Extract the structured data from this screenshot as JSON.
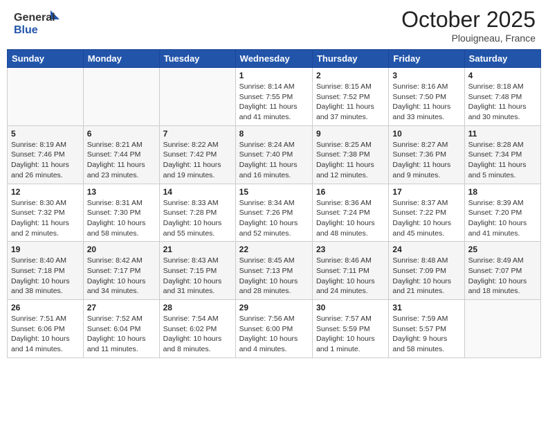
{
  "header": {
    "logo_general": "General",
    "logo_blue": "Blue",
    "month_title": "October 2025",
    "location": "Plouigneau, France"
  },
  "days_of_week": [
    "Sunday",
    "Monday",
    "Tuesday",
    "Wednesday",
    "Thursday",
    "Friday",
    "Saturday"
  ],
  "weeks": [
    [
      {
        "day": "",
        "info": ""
      },
      {
        "day": "",
        "info": ""
      },
      {
        "day": "",
        "info": ""
      },
      {
        "day": "1",
        "info": "Sunrise: 8:14 AM\nSunset: 7:55 PM\nDaylight: 11 hours and 41 minutes."
      },
      {
        "day": "2",
        "info": "Sunrise: 8:15 AM\nSunset: 7:52 PM\nDaylight: 11 hours and 37 minutes."
      },
      {
        "day": "3",
        "info": "Sunrise: 8:16 AM\nSunset: 7:50 PM\nDaylight: 11 hours and 33 minutes."
      },
      {
        "day": "4",
        "info": "Sunrise: 8:18 AM\nSunset: 7:48 PM\nDaylight: 11 hours and 30 minutes."
      }
    ],
    [
      {
        "day": "5",
        "info": "Sunrise: 8:19 AM\nSunset: 7:46 PM\nDaylight: 11 hours and 26 minutes."
      },
      {
        "day": "6",
        "info": "Sunrise: 8:21 AM\nSunset: 7:44 PM\nDaylight: 11 hours and 23 minutes."
      },
      {
        "day": "7",
        "info": "Sunrise: 8:22 AM\nSunset: 7:42 PM\nDaylight: 11 hours and 19 minutes."
      },
      {
        "day": "8",
        "info": "Sunrise: 8:24 AM\nSunset: 7:40 PM\nDaylight: 11 hours and 16 minutes."
      },
      {
        "day": "9",
        "info": "Sunrise: 8:25 AM\nSunset: 7:38 PM\nDaylight: 11 hours and 12 minutes."
      },
      {
        "day": "10",
        "info": "Sunrise: 8:27 AM\nSunset: 7:36 PM\nDaylight: 11 hours and 9 minutes."
      },
      {
        "day": "11",
        "info": "Sunrise: 8:28 AM\nSunset: 7:34 PM\nDaylight: 11 hours and 5 minutes."
      }
    ],
    [
      {
        "day": "12",
        "info": "Sunrise: 8:30 AM\nSunset: 7:32 PM\nDaylight: 11 hours and 2 minutes."
      },
      {
        "day": "13",
        "info": "Sunrise: 8:31 AM\nSunset: 7:30 PM\nDaylight: 10 hours and 58 minutes."
      },
      {
        "day": "14",
        "info": "Sunrise: 8:33 AM\nSunset: 7:28 PM\nDaylight: 10 hours and 55 minutes."
      },
      {
        "day": "15",
        "info": "Sunrise: 8:34 AM\nSunset: 7:26 PM\nDaylight: 10 hours and 52 minutes."
      },
      {
        "day": "16",
        "info": "Sunrise: 8:36 AM\nSunset: 7:24 PM\nDaylight: 10 hours and 48 minutes."
      },
      {
        "day": "17",
        "info": "Sunrise: 8:37 AM\nSunset: 7:22 PM\nDaylight: 10 hours and 45 minutes."
      },
      {
        "day": "18",
        "info": "Sunrise: 8:39 AM\nSunset: 7:20 PM\nDaylight: 10 hours and 41 minutes."
      }
    ],
    [
      {
        "day": "19",
        "info": "Sunrise: 8:40 AM\nSunset: 7:18 PM\nDaylight: 10 hours and 38 minutes."
      },
      {
        "day": "20",
        "info": "Sunrise: 8:42 AM\nSunset: 7:17 PM\nDaylight: 10 hours and 34 minutes."
      },
      {
        "day": "21",
        "info": "Sunrise: 8:43 AM\nSunset: 7:15 PM\nDaylight: 10 hours and 31 minutes."
      },
      {
        "day": "22",
        "info": "Sunrise: 8:45 AM\nSunset: 7:13 PM\nDaylight: 10 hours and 28 minutes."
      },
      {
        "day": "23",
        "info": "Sunrise: 8:46 AM\nSunset: 7:11 PM\nDaylight: 10 hours and 24 minutes."
      },
      {
        "day": "24",
        "info": "Sunrise: 8:48 AM\nSunset: 7:09 PM\nDaylight: 10 hours and 21 minutes."
      },
      {
        "day": "25",
        "info": "Sunrise: 8:49 AM\nSunset: 7:07 PM\nDaylight: 10 hours and 18 minutes."
      }
    ],
    [
      {
        "day": "26",
        "info": "Sunrise: 7:51 AM\nSunset: 6:06 PM\nDaylight: 10 hours and 14 minutes."
      },
      {
        "day": "27",
        "info": "Sunrise: 7:52 AM\nSunset: 6:04 PM\nDaylight: 10 hours and 11 minutes."
      },
      {
        "day": "28",
        "info": "Sunrise: 7:54 AM\nSunset: 6:02 PM\nDaylight: 10 hours and 8 minutes."
      },
      {
        "day": "29",
        "info": "Sunrise: 7:56 AM\nSunset: 6:00 PM\nDaylight: 10 hours and 4 minutes."
      },
      {
        "day": "30",
        "info": "Sunrise: 7:57 AM\nSunset: 5:59 PM\nDaylight: 10 hours and 1 minute."
      },
      {
        "day": "31",
        "info": "Sunrise: 7:59 AM\nSunset: 5:57 PM\nDaylight: 9 hours and 58 minutes."
      },
      {
        "day": "",
        "info": ""
      }
    ]
  ]
}
